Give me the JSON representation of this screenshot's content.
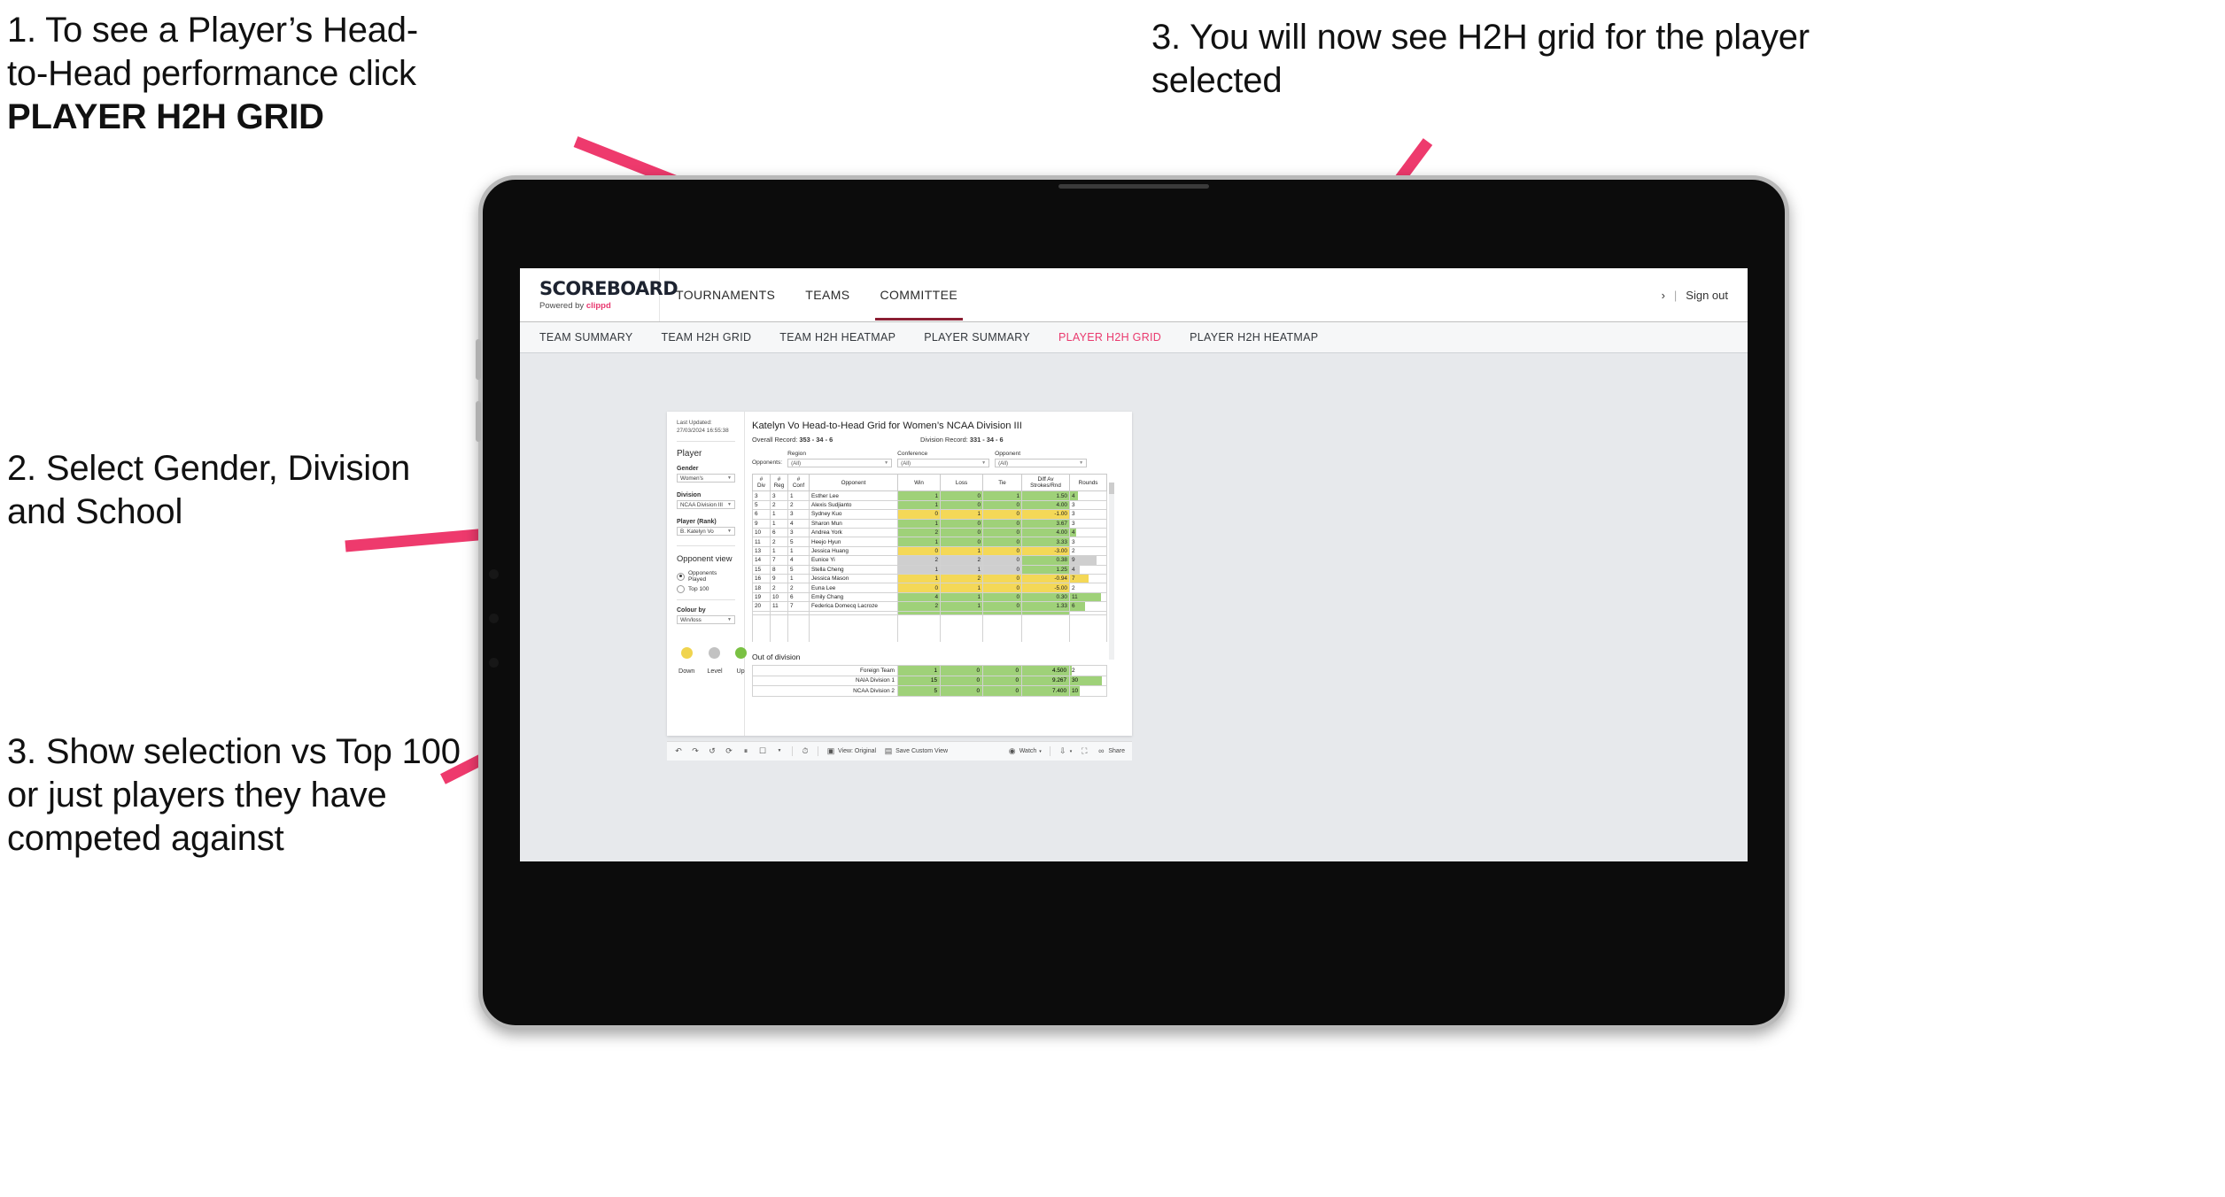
{
  "annotations": [
    {
      "id": "a1",
      "line1": "1. To see a Player’s Head-",
      "line2": "to-Head performance click",
      "bold": "PLAYER H2H GRID"
    },
    {
      "id": "a2",
      "text": "2. Select Gender, Division and School"
    },
    {
      "id": "a3",
      "text": "3. Show selection vs Top 100 or just players they have competed against"
    },
    {
      "id": "a4",
      "text": "3. You will now see H2H grid for the player selected"
    }
  ],
  "header": {
    "logo": "SCOREBOARD",
    "powered_prefix": "Powered by",
    "powered_brand": "clippd",
    "nav": [
      {
        "label": "TOURNAMENTS",
        "active": false
      },
      {
        "label": "TEAMS",
        "active": false
      },
      {
        "label": "COMMITTEE",
        "active": true
      }
    ],
    "chevron": "›",
    "separator": "|",
    "sign_out": "Sign out"
  },
  "subnav": {
    "tabs": [
      {
        "label": "TEAM SUMMARY",
        "active": false
      },
      {
        "label": "TEAM H2H GRID",
        "active": false
      },
      {
        "label": "TEAM H2H HEATMAP",
        "active": false
      },
      {
        "label": "PLAYER SUMMARY",
        "active": false
      },
      {
        "label": "PLAYER H2H GRID",
        "active": true
      },
      {
        "label": "PLAYER H2H HEATMAP",
        "active": false
      }
    ],
    "active_color": "#ea3a6e"
  },
  "filters": {
    "last_updated": "Last Updated: 27/03/2024 16:55:38",
    "player_heading": "Player",
    "gender_label": "Gender",
    "gender_value": "Women's",
    "division_label": "Division",
    "division_value": "NCAA Division III",
    "player_rank_label": "Player (Rank)",
    "player_rank_value": "B. Katelyn Vo",
    "opponent_view_heading": "Opponent view",
    "opponent_options": [
      {
        "label": "Opponents Played",
        "selected": true
      },
      {
        "label": "Top 100",
        "selected": false
      }
    ],
    "colour_by_label": "Colour by",
    "colour_by_value": "Win/loss",
    "legend": [
      {
        "label": "Down",
        "color": "#f0d44e"
      },
      {
        "label": "Level",
        "color": "#c2c2c2"
      },
      {
        "label": "Up",
        "color": "#7ac143"
      }
    ]
  },
  "main": {
    "title": "Katelyn Vo Head-to-Head Grid for Women’s NCAA Division III",
    "overall_record_label": "Overall Record:",
    "overall_record_value": "353 -  34 - 6",
    "division_record_label": "Division Record:",
    "division_record_value": "331 -  34 - 6",
    "opponents_label": "Opponents:",
    "opponent_filters": [
      {
        "caption": "Region",
        "value": "(All)"
      },
      {
        "caption": "Conference",
        "value": "(All)"
      },
      {
        "caption": "Opponent",
        "value": "(All)"
      }
    ],
    "columns": [
      {
        "l1": "#",
        "l2": "Div"
      },
      {
        "l1": "#",
        "l2": "Reg"
      },
      {
        "l1": "#",
        "l2": "Conf"
      },
      {
        "l1": "Opponent",
        "l2": ""
      },
      {
        "l1": "Win",
        "l2": ""
      },
      {
        "l1": "Loss",
        "l2": ""
      },
      {
        "l1": "Tie",
        "l2": ""
      },
      {
        "l1": "Diff Av",
        "l2": "Strokes/Rnd"
      },
      {
        "l1": "Rounds",
        "l2": ""
      }
    ],
    "rows": [
      {
        "div": "3",
        "reg": "3",
        "conf": "1",
        "opponent": "Esther Lee",
        "win": "1",
        "loss": "0",
        "tie": "1",
        "diff": "1.50",
        "rounds": "4",
        "tone": "g",
        "bar": 22
      },
      {
        "div": "5",
        "reg": "2",
        "conf": "2",
        "opponent": "Alexis Sudjianto",
        "win": "1",
        "loss": "0",
        "tie": "0",
        "diff": "4.00",
        "rounds": "3",
        "tone": "g",
        "bar": 0
      },
      {
        "div": "6",
        "reg": "1",
        "conf": "3",
        "opponent": "Sydney Kuo",
        "win": "0",
        "loss": "1",
        "tie": "0",
        "diff": "-1.00",
        "rounds": "3",
        "tone": "y",
        "bar": 0
      },
      {
        "div": "9",
        "reg": "1",
        "conf": "4",
        "opponent": "Sharon Mun",
        "win": "1",
        "loss": "0",
        "tie": "0",
        "diff": "3.67",
        "rounds": "3",
        "tone": "g",
        "bar": 0
      },
      {
        "div": "10",
        "reg": "6",
        "conf": "3",
        "opponent": "Andrea York",
        "win": "2",
        "loss": "0",
        "tie": "0",
        "diff": "4.00",
        "rounds": "4",
        "tone": "g",
        "bar": 17
      },
      {
        "div": "11",
        "reg": "2",
        "conf": "5",
        "opponent": "Heejo Hyun",
        "win": "1",
        "loss": "0",
        "tie": "0",
        "diff": "3.33",
        "rounds": "3",
        "tone": "g",
        "bar": 0
      },
      {
        "div": "13",
        "reg": "1",
        "conf": "1",
        "opponent": "Jessica Huang",
        "win": "0",
        "loss": "1",
        "tie": "0",
        "diff": "-3.00",
        "rounds": "2",
        "tone": "y",
        "bar": 0
      },
      {
        "div": "14",
        "reg": "7",
        "conf": "4",
        "opponent": "Eunice Yi",
        "win": "2",
        "loss": "2",
        "tie": "0",
        "diff": "0.38",
        "rounds": "9",
        "tone": "gr",
        "bar": 72,
        "diff_tone": "g"
      },
      {
        "div": "15",
        "reg": "8",
        "conf": "5",
        "opponent": "Stella Cheng",
        "win": "1",
        "loss": "1",
        "tie": "0",
        "diff": "1.25",
        "rounds": "4",
        "tone": "gr",
        "bar": 28,
        "diff_tone": "g"
      },
      {
        "div": "16",
        "reg": "9",
        "conf": "1",
        "opponent": "Jessica Mason",
        "win": "1",
        "loss": "2",
        "tie": "0",
        "diff": "-0.94",
        "rounds": "7",
        "tone": "y",
        "bar": 52
      },
      {
        "div": "18",
        "reg": "2",
        "conf": "2",
        "opponent": "Euna Lee",
        "win": "0",
        "loss": "1",
        "tie": "0",
        "diff": "-5.00",
        "rounds": "2",
        "tone": "y",
        "bar": 0
      },
      {
        "div": "19",
        "reg": "10",
        "conf": "6",
        "opponent": "Emily Chang",
        "win": "4",
        "loss": "1",
        "tie": "0",
        "diff": "0.30",
        "rounds": "11",
        "tone": "g",
        "bar": 86
      },
      {
        "div": "20",
        "reg": "11",
        "conf": "7",
        "opponent": "Federica Domecq Lacroze",
        "win": "2",
        "loss": "1",
        "tie": "0",
        "diff": "1.33",
        "rounds": "6",
        "tone": "g",
        "bar": 42
      }
    ],
    "out_of_division_title": "Out of division",
    "out_of_division_rows": [
      {
        "name": "Foreign Team",
        "win": "1",
        "loss": "0",
        "tie": "0",
        "diff": "4.500",
        "rounds": "2",
        "bar": 4
      },
      {
        "name": "NAIA Division 1",
        "win": "15",
        "loss": "0",
        "tie": "0",
        "diff": "9.267",
        "rounds": "30",
        "bar": 88
      },
      {
        "name": "NCAA Division 2",
        "win": "5",
        "loss": "0",
        "tie": "0",
        "diff": "7.400",
        "rounds": "10",
        "bar": 26
      }
    ]
  },
  "toolbar": {
    "view_label": "View: Original",
    "save_label": "Save Custom View",
    "watch_label": "Watch",
    "share_label": "Share",
    "caret": "▾"
  },
  "colors": {
    "accent": "#ea3a6e",
    "arrow": "#ee3a6d",
    "green": "#9fd179",
    "yellow": "#f4d857",
    "grey": "#cfcfcf"
  }
}
